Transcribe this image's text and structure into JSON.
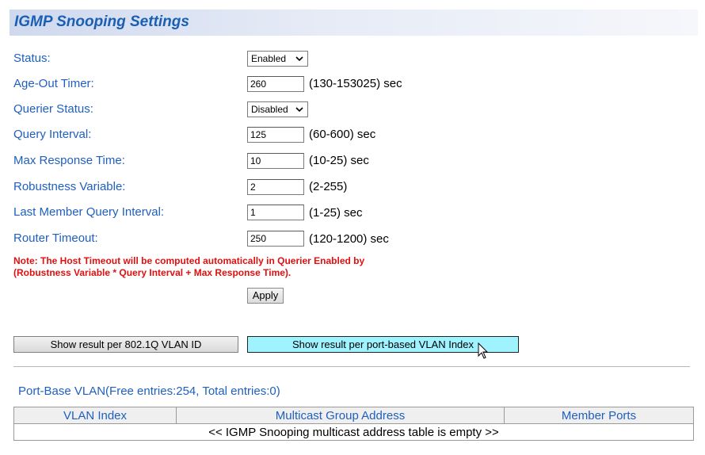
{
  "page": {
    "title": "IGMP Snooping Settings"
  },
  "form": {
    "status": {
      "label": "Status:",
      "value": "Enabled"
    },
    "age_out_timer": {
      "label": "Age-Out Timer:",
      "value": "260",
      "range": "(130-153025) sec"
    },
    "querier_status": {
      "label": "Querier Status:",
      "value": "Disabled"
    },
    "query_interval": {
      "label": "Query Interval:",
      "value": "125",
      "range": "(60-600) sec"
    },
    "max_response_time": {
      "label": "Max Response Time:",
      "value": "10",
      "range": "(10-25) sec"
    },
    "robustness_variable": {
      "label": "Robustness Variable:",
      "value": "2",
      "range": "(2-255)"
    },
    "last_member_query_interval": {
      "label": "Last Member Query Interval:",
      "value": "1",
      "range": "(1-25) sec"
    },
    "router_timeout": {
      "label": "Router Timeout:",
      "value": "250",
      "range": "(120-1200) sec"
    }
  },
  "note": {
    "line1": "Note: The Host Timeout will be computed automatically in Querier Enabled by",
    "line2": "(Robustness Variable * Query Interval + Max Response Time)."
  },
  "apply_label": "Apply",
  "view_tabs": {
    "per_vlan_id": "Show result per 802.1Q VLAN ID",
    "per_port_based": "Show result per port-based VLAN Index"
  },
  "vlan_section": {
    "title": "Port-Base VLAN(Free entries:254, Total entries:0)",
    "columns": [
      "VLAN Index",
      "Multicast Group Address",
      "Member Ports"
    ],
    "empty_message": "<< IGMP Snooping multicast address table is empty >>"
  },
  "colors": {
    "label_blue": "#1f5fbf",
    "note_red": "#e01010",
    "active_tab": "#9ef3ff"
  }
}
